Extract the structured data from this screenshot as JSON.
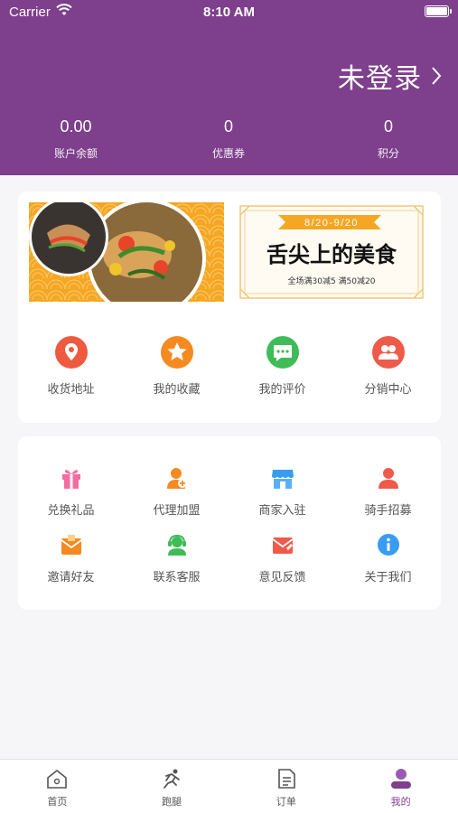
{
  "status": {
    "carrier": "Carrier",
    "time": "8:10 AM"
  },
  "header": {
    "login_text": "未登录",
    "stats": [
      {
        "value": "0.00",
        "label": "账户余额"
      },
      {
        "value": "0",
        "label": "优惠券"
      },
      {
        "value": "0",
        "label": "积分"
      }
    ]
  },
  "banner": {
    "date": "8/20-9/20",
    "title": "舌尖上的美食",
    "promo": "全场满30减5 满50减20"
  },
  "quick_menu": [
    {
      "label": "收货地址",
      "icon": "location-icon",
      "color": "#ee5a3f"
    },
    {
      "label": "我的收藏",
      "icon": "star-icon",
      "color": "#f58a20"
    },
    {
      "label": "我的评价",
      "icon": "chat-icon",
      "color": "#3fbc58"
    },
    {
      "label": "分销中心",
      "icon": "people-icon",
      "color": "#ef5a4a"
    }
  ],
  "services": [
    {
      "label": "兑换礼品",
      "icon": "gift-icon",
      "color": "#f56ba2"
    },
    {
      "label": "代理加盟",
      "icon": "agent-icon",
      "color": "#f58a20"
    },
    {
      "label": "商家入驻",
      "icon": "store-icon",
      "color": "#3a9cf0"
    },
    {
      "label": "骑手招募",
      "icon": "rider-icon",
      "color": "#ef5a4a"
    },
    {
      "label": "邀请好友",
      "icon": "invite-icon",
      "color": "#f58a20"
    },
    {
      "label": "联系客服",
      "icon": "headset-icon",
      "color": "#3fbc58"
    },
    {
      "label": "意见反馈",
      "icon": "feedback-icon",
      "color": "#ef5a4a"
    },
    {
      "label": "关于我们",
      "icon": "info-icon",
      "color": "#3a9cf0"
    }
  ],
  "tabs": [
    {
      "label": "首页",
      "icon": "home-icon"
    },
    {
      "label": "跑腿",
      "icon": "runner-icon"
    },
    {
      "label": "订单",
      "icon": "order-icon"
    },
    {
      "label": "我的",
      "icon": "profile-icon",
      "active": true
    }
  ],
  "colors": {
    "header": "#7e3f8c",
    "accent": "#7e3f8c",
    "banner_orange": "#f5a623"
  }
}
